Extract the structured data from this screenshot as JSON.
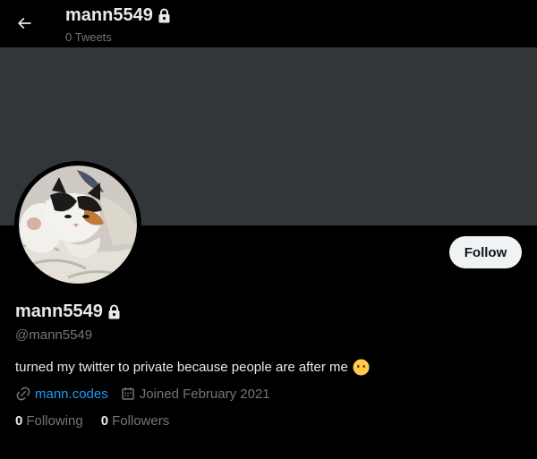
{
  "header": {
    "title": "mann5549",
    "tweet_count": "0 Tweets"
  },
  "profile": {
    "display_name": "mann5549",
    "handle": "@mann5549",
    "bio": "turned my twitter to private because people are after me",
    "website": "mann.codes",
    "joined": "Joined February 2021",
    "following_count": "0",
    "following_label": "Following",
    "followers_count": "0",
    "followers_label": "Followers",
    "follow_label": "Follow",
    "protected": true
  },
  "icons": {
    "back": "arrow-left-icon",
    "lock": "lock-icon",
    "link": "link-icon",
    "calendar": "calendar-icon",
    "emoji": "face-without-mouth-emoji"
  },
  "colors": {
    "background": "#000000",
    "banner": "#333639",
    "text_primary": "#e7e9ea",
    "text_secondary": "#71767b",
    "link": "#1d9bf0",
    "follow_button": "#eff3f4"
  }
}
